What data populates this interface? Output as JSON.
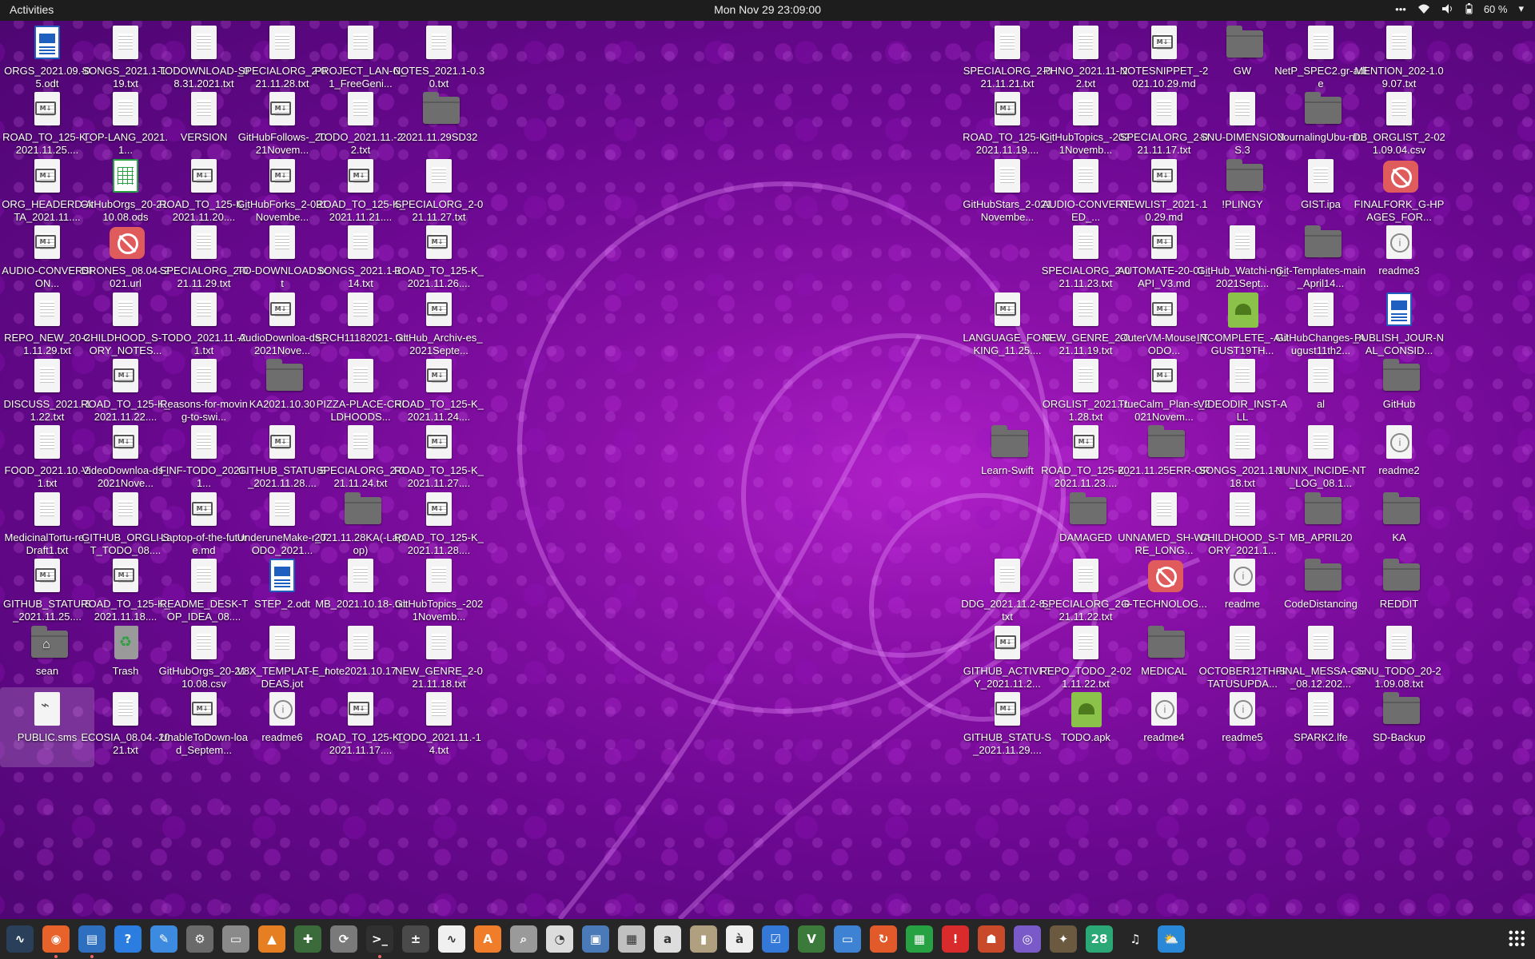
{
  "topbar": {
    "activities": "Activities",
    "clock": "Mon Nov 29  23:09:00",
    "battery": "60 %"
  },
  "left_columns": [
    [
      {
        "label": "ORGS_2021.09.-05.odt",
        "type": "odt"
      },
      {
        "label": "ROAD_TO_125-K_2021.11.25....",
        "type": "md"
      },
      {
        "label": "ORG_HEADERD-ATA_2021.11....",
        "type": "md"
      },
      {
        "label": "AUDIO-CONVERSION...",
        "type": "md"
      },
      {
        "label": "REPO_NEW_20-21.11.29.txt",
        "type": "txt"
      },
      {
        "label": "DISCUSS_2021.-11.22.txt",
        "type": "txt"
      },
      {
        "label": "FOOD_2021.10.-21.txt",
        "type": "txt"
      },
      {
        "label": "MedicinalTortu-re_Draft1.txt",
        "type": "txt"
      },
      {
        "label": "GITHUB_STATU-S_2021.11.25....",
        "type": "md"
      },
      {
        "label": "sean",
        "type": "home"
      },
      {
        "label": "PUBLIC.sms",
        "type": "sms",
        "selected": true
      }
    ],
    [
      {
        "label": "SONGS_2021.1-1.19.txt",
        "type": "txt"
      },
      {
        "label": "TOP-LANG_2021.1...",
        "type": "txt"
      },
      {
        "label": "GitHubOrgs_20-21.10.08.ods",
        "type": "ods"
      },
      {
        "label": "DRONES_08.04-.2021.url",
        "type": "url"
      },
      {
        "label": "CHILDHOOD_S-TORY_NOTES...",
        "type": "txt"
      },
      {
        "label": "ROAD_TO_125-K_2021.11.22....",
        "type": "md"
      },
      {
        "label": "VideoDownloa-ds_2021Nove...",
        "type": "md"
      },
      {
        "label": "GITHUB_ORGLI-ST_TODO_08....",
        "type": "txt"
      },
      {
        "label": "ROAD_TO_125-K_2021.11.18....",
        "type": "md"
      },
      {
        "label": "Trash",
        "type": "trash"
      },
      {
        "label": "ECOSIA_08.04.-2021.txt",
        "type": "txt"
      }
    ],
    [
      {
        "label": "TODOWNLOAD-_08.31.2021.txt",
        "type": "txt"
      },
      {
        "label": "VERSION",
        "type": "txt"
      },
      {
        "label": "ROAD_TO_125-K_2021.11.20....",
        "type": "md"
      },
      {
        "label": "SPECIALORG_2-021.11.29.txt",
        "type": "txt"
      },
      {
        "label": "TODO_2021.11.-21.txt",
        "type": "txt"
      },
      {
        "label": "Reasons-for-moving-to-swi...",
        "type": "txt"
      },
      {
        "label": "FINF-TODO_2021.1...",
        "type": "txt"
      },
      {
        "label": "Laptop-of-the-future.md",
        "type": "md"
      },
      {
        "label": "README_DESK-TOP_IDEA_08....",
        "type": "txt"
      },
      {
        "label": "GitHubOrgs_20-21.10.08.csv",
        "type": "txt"
      },
      {
        "label": "UnableToDown-load_Septem...",
        "type": "md"
      }
    ],
    [
      {
        "label": "SPECIALORG_2-021.11.28.txt",
        "type": "txt"
      },
      {
        "label": "GitHubFollows-_2021Novem...",
        "type": "md"
      },
      {
        "label": "GitHubForks_2-021Novembe...",
        "type": "md"
      },
      {
        "label": "TO-DOWNLOAD.txt",
        "type": "txt"
      },
      {
        "label": "AudioDownloa-ds_2021Nove...",
        "type": "md"
      },
      {
        "label": "KA2021.10.30",
        "type": "folder"
      },
      {
        "label": "GITHUB_STATU-S_2021.11.28....",
        "type": "md"
      },
      {
        "label": "UnderuneMake-r_TODO_2021...",
        "type": "txt"
      },
      {
        "label": "STEP_2.odt",
        "type": "odt"
      },
      {
        "label": "V8X_TEMPLAT-E_IDEAS.jot",
        "type": "txt"
      },
      {
        "label": "readme6",
        "type": "readme"
      }
    ],
    [
      {
        "label": "PROJECT_LAN-G_1_FreeGeni...",
        "type": "txt"
      },
      {
        "label": "TODO_2021.11.-22.txt",
        "type": "txt"
      },
      {
        "label": "ROAD_TO_125-K_2021.11.21....",
        "type": "md"
      },
      {
        "label": "SONGS_2021.1-1.14.txt",
        "type": "txt"
      },
      {
        "label": "SRCH11182021-.txt",
        "type": "txt"
      },
      {
        "label": "PIZZA-PLACE-CHILDHOODS...",
        "type": "txt"
      },
      {
        "label": "SPECIALORG_2-021.11.24.txt",
        "type": "txt"
      },
      {
        "label": "2021.11.28KA(-Laptop)",
        "type": "folder"
      },
      {
        "label": "MB_2021.10.18-.txt",
        "type": "txt"
      },
      {
        "label": "note2021.10.17",
        "type": "txt"
      },
      {
        "label": "ROAD_TO_125-K_2021.11.17....",
        "type": "md"
      }
    ],
    [
      {
        "label": "NOTES_2021.1-0.30.txt",
        "type": "txt"
      },
      {
        "label": "2021.11.29SD32",
        "type": "folder"
      },
      {
        "label": "SPECIALORG_2-021.11.27.txt",
        "type": "txt"
      },
      {
        "label": "ROAD_TO_125-K_2021.11.26....",
        "type": "md"
      },
      {
        "label": "GitHub_Archiv-es_2021Septe...",
        "type": "md"
      },
      {
        "label": "ROAD_TO_125-K_2021.11.24....",
        "type": "md"
      },
      {
        "label": "ROAD_TO_125-K_2021.11.27....",
        "type": "md"
      },
      {
        "label": "ROAD_TO_125-K_2021.11.28....",
        "type": "md"
      },
      {
        "label": "GitHubTopics_-2021Novemb...",
        "type": "txt"
      },
      {
        "label": "NEW_GENRE_2-021.11.18.txt",
        "type": "txt"
      },
      {
        "label": "TODO_2021.11.-14.txt",
        "type": "txt"
      }
    ]
  ],
  "right_columns": [
    [
      {
        "label": "SPECIALORG_2-021.11.21.txt",
        "type": "txt"
      },
      {
        "label": "ROAD_TO_125-K_2021.11.19....",
        "type": "md"
      },
      {
        "label": "GitHubStars_2-021Novembe...",
        "type": "txt"
      },
      null,
      {
        "label": "LANGUAGE_FO-RKING_11.25....",
        "type": "md"
      },
      null,
      {
        "label": "Learn-Swift",
        "type": "folder"
      },
      null,
      {
        "label": "DDG_2021.11.2-8_.txt",
        "type": "txt"
      },
      {
        "label": "GITHUB_ACTIVI-TY_2021.11.2...",
        "type": "md"
      },
      {
        "label": "GITHUB_STATU-S_2021.11.29....",
        "type": "md"
      }
    ],
    [
      {
        "label": "PHNO_2021.11-.22.txt",
        "type": "txt"
      },
      {
        "label": "GitHubTopics_-2021Novemb...",
        "type": "txt"
      },
      {
        "label": "AUDIO-CONVERTED_...",
        "type": "txt"
      },
      {
        "label": "SPECIALORG_2-021.11.23.txt",
        "type": "txt"
      },
      {
        "label": "NEW_GENRE_2-021.11.19.txt",
        "type": "txt"
      },
      {
        "label": "ORGLIST_2021.-11.28.txt",
        "type": "txt"
      },
      {
        "label": "ROAD_TO_125-K_2021.11.23....",
        "type": "md"
      },
      {
        "label": "DAMAGED",
        "type": "folder"
      },
      {
        "label": "SPECIALORG_2-021.11.22.txt",
        "type": "txt"
      },
      {
        "label": "REPO_TODO_2-021.11.22.txt",
        "type": "txt"
      },
      {
        "label": "TODO.apk",
        "type": "apk"
      }
    ],
    [
      {
        "label": "NOTESNIPPET_-2021.10.29.md",
        "type": "md"
      },
      {
        "label": "SPECIALORG_2-021.11.17.txt",
        "type": "txt"
      },
      {
        "label": "NEWLIST_2021-.10.29.md",
        "type": "md"
      },
      {
        "label": "AUTOMATE-20-01_API_V3.md",
        "type": "md"
      },
      {
        "label": "OuterVM-Mouse_TODO...",
        "type": "md"
      },
      {
        "label": "TrueCalm_Plan-s_2021Novem...",
        "type": "md"
      },
      {
        "label": "2021.11.25ERR-OR",
        "type": "folder"
      },
      {
        "label": "UNNAMED_SH-WARE_LONG...",
        "type": "txt"
      },
      {
        "label": "G-TECHNOLOG...",
        "type": "url"
      },
      {
        "label": "MEDICAL",
        "type": "folder"
      },
      {
        "label": "readme4",
        "type": "readme"
      }
    ],
    [
      {
        "label": "GW",
        "type": "folder"
      },
      {
        "label": "SNU-DIMENSIONS.3",
        "type": "txt"
      },
      {
        "label": "!PLINGY",
        "type": "folder"
      },
      {
        "label": "GitHub_Watchi-ng_2021Sept...",
        "type": "txt"
      },
      {
        "label": "INCOMPLETE_-AUGUST19TH...",
        "type": "apk"
      },
      {
        "label": "VIDEODIR_INST-ALL",
        "type": "txt"
      },
      {
        "label": "SONGS_2021.1-1.18.txt",
        "type": "txt"
      },
      {
        "label": "CHILDHOOD_S-TORY_2021.1...",
        "type": "txt"
      },
      {
        "label": "readme",
        "type": "readme"
      },
      {
        "label": "OCTOBER12TH-STATUSUPDA...",
        "type": "txt"
      },
      {
        "label": "readme5",
        "type": "readme"
      }
    ],
    [
      {
        "label": "NetP_SPEC2.gr-adle",
        "type": "txt"
      },
      {
        "label": "JournalingUbu-ntu",
        "type": "folder"
      },
      {
        "label": "GIST.ipa",
        "type": "txt"
      },
      {
        "label": "Git-Templates-main_April14...",
        "type": "folder"
      },
      {
        "label": "GitHubChanges-_August11th2...",
        "type": "txt"
      },
      {
        "label": "al",
        "type": "txt"
      },
      {
        "label": "NUNIX_INCIDE-NT_LOG_08.1...",
        "type": "txt"
      },
      {
        "label": "MB_APRIL20",
        "type": "folder"
      },
      {
        "label": "CodeDistancing",
        "type": "folder"
      },
      {
        "label": "FINAL_MESSA-GE_08.12.202...",
        "type": "txt"
      },
      {
        "label": "SPARK2.lfe",
        "type": "txt"
      }
    ],
    [
      {
        "label": "MENTION_202-1.09.07.txt",
        "type": "txt"
      },
      {
        "label": "DB_ORGLIST_2-021.09.04.csv",
        "type": "txt"
      },
      {
        "label": "FINALFORK_G-HPAGES_FOR...",
        "type": "url"
      },
      {
        "label": "readme3",
        "type": "readme"
      },
      {
        "label": "PUBLISH_JOUR-NAL_CONSID...",
        "type": "odt"
      },
      {
        "label": "GitHub",
        "type": "folder"
      },
      {
        "label": "readme2",
        "type": "readme"
      },
      {
        "label": "KA",
        "type": "folder"
      },
      {
        "label": "REDDIT",
        "type": "folder"
      },
      {
        "label": "SNU_TODO_20-21.09.08.txt",
        "type": "txt"
      },
      {
        "label": "SD-Backup",
        "type": "folder"
      }
    ]
  ],
  "dock": [
    {
      "name": "system-monitor-icon",
      "bg": "#2a3f5a",
      "glyph": "∿"
    },
    {
      "name": "firefox-icon",
      "bg": "#e8632a",
      "glyph": "◉"
    },
    {
      "name": "document-viewer-icon",
      "bg": "#2f6fbf",
      "glyph": "▤"
    },
    {
      "name": "help-icon",
      "bg": "#2b7de0",
      "glyph": "?"
    },
    {
      "name": "text-editor-icon",
      "bg": "#3d8be0",
      "glyph": "✎"
    },
    {
      "name": "settings-icon",
      "bg": "#6a6a6a",
      "glyph": "⚙"
    },
    {
      "name": "files-icon",
      "bg": "#8a8a8a",
      "glyph": "▭"
    },
    {
      "name": "vlc-icon",
      "bg": "#e67e22",
      "glyph": "▲"
    },
    {
      "name": "puzzle-icon",
      "bg": "#3b6b3b",
      "glyph": "✚"
    },
    {
      "name": "software-updater-icon",
      "bg": "#7a7a7a",
      "glyph": "⟳"
    },
    {
      "name": "terminal-icon",
      "bg": "#303030",
      "glyph": ">_"
    },
    {
      "name": "calculator-icon",
      "bg": "#4a4a4a",
      "glyph": "±"
    },
    {
      "name": "system-graph-icon",
      "bg": "#f0f0f0",
      "glyph": "∿"
    },
    {
      "name": "app-store-icon",
      "bg": "#f07d2a",
      "glyph": "A"
    },
    {
      "name": "screenshot-icon",
      "bg": "#9a9a9a",
      "glyph": "⌕"
    },
    {
      "name": "disk-usage-icon",
      "bg": "#dcdcdc",
      "glyph": "◔"
    },
    {
      "name": "image-viewer-icon",
      "bg": "#4a7ab8",
      "glyph": "▣"
    },
    {
      "name": "photos-icon",
      "bg": "#c0c0c0",
      "glyph": "▦"
    },
    {
      "name": "font-viewer-icon",
      "bg": "#dddddd",
      "glyph": "a"
    },
    {
      "name": "archive-manager-icon",
      "bg": "#b0a080",
      "glyph": "▮"
    },
    {
      "name": "character-map-icon",
      "bg": "#eeeeee",
      "glyph": "à"
    },
    {
      "name": "todo-icon",
      "bg": "#3478d8",
      "glyph": "☑"
    },
    {
      "name": "vim-icon",
      "bg": "#3b7a3b",
      "glyph": "V"
    },
    {
      "name": "remote-desktop-icon",
      "bg": "#3e82d4",
      "glyph": "▭"
    },
    {
      "name": "backup-icon",
      "bg": "#e25a2a",
      "glyph": "↻"
    },
    {
      "name": "spreadsheet-icon",
      "bg": "#27a243",
      "glyph": "▦"
    },
    {
      "name": "alert-icon",
      "bg": "#d92b2b",
      "glyph": "!"
    },
    {
      "name": "game-icon",
      "bg": "#c84a2a",
      "glyph": "☗"
    },
    {
      "name": "camera-icon",
      "bg": "#7a5ac8",
      "glyph": "◎"
    },
    {
      "name": "gimp-icon",
      "bg": "#6b5a40",
      "glyph": "✦"
    },
    {
      "name": "calendar-icon",
      "bg": "#2aa876",
      "glyph": "28"
    },
    {
      "name": "music-icon",
      "bg": "#262626",
      "glyph": "♫"
    },
    {
      "name": "weather-icon",
      "bg": "#2a88d8",
      "glyph": "⛅"
    }
  ]
}
